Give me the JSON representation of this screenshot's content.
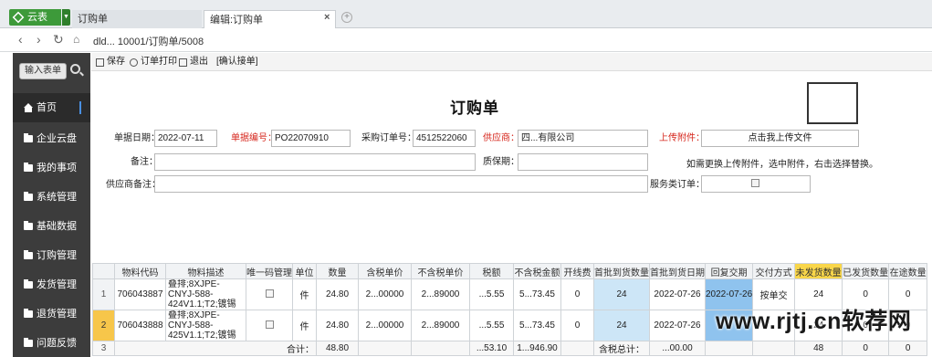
{
  "browser": {
    "brand": "云表",
    "tabs": [
      {
        "label": "订购单"
      },
      {
        "label": "编辑:订购单"
      }
    ],
    "close_glyph": "×",
    "add_glyph": "+",
    "address": "dld... 10001/订购单/5008"
  },
  "sidebar": {
    "search_button": "输入表单",
    "items": [
      {
        "label": "首页"
      },
      {
        "label": "企业云盘"
      },
      {
        "label": "我的事项"
      },
      {
        "label": "系统管理"
      },
      {
        "label": "基础数据"
      },
      {
        "label": "订购管理"
      },
      {
        "label": "发货管理"
      },
      {
        "label": "退货管理"
      },
      {
        "label": "问题反馈"
      }
    ]
  },
  "toolbar": {
    "save": "保存",
    "print": "订单打印",
    "exit": "退出",
    "confirm": "[确认接单]"
  },
  "form": {
    "title": "订购单",
    "doc_date_label": "单据日期：",
    "doc_date": "2022-07-11",
    "doc_no_label": "单据编号：",
    "doc_no": "PO22070910",
    "po_no_label": "采购订单号：",
    "po_no": "4512522060",
    "supplier_label": "供应商：",
    "supplier": "四...有限公司",
    "attachment_label": "上传附件：",
    "upload_button": "点击我上传文件",
    "remark_label": "备注：",
    "remark": "",
    "warranty_label": "质保期：",
    "warranty": "",
    "hint": "如需更换上传附件，选中附件，右击选择替换。",
    "supplier_remark_label": "供应商备注：",
    "supplier_remark": "",
    "service_order_label": "服务类订单："
  },
  "table": {
    "headers": [
      "",
      "物料代码",
      "物料描述",
      "唯一码管理",
      "单位",
      "数量",
      "含税单价",
      "不含税单价",
      "税额",
      "不含税金额",
      "开线费",
      "首批到货数量",
      "首批到货日期",
      "回复交期",
      "交付方式",
      "未发货数量",
      "已发货数量",
      "在途数量"
    ],
    "rows": [
      {
        "no": "1",
        "code": "706043887",
        "desc": "叠排;8XJPE-CNYJ-588-424V1.1;T2;镀锡",
        "unit": "件",
        "qty": "24.80",
        "price_tax": "2...00000",
        "price_notax": "2...89000",
        "tax": "...5.55",
        "amount_notax": "5...73.45",
        "line_fee": "0",
        "first_qty": "24",
        "first_date": "2022-07-26",
        "reply_date": "2022-07-26",
        "delivery": "按单交",
        "unshipped": "24",
        "shipped": "0",
        "transit": "0"
      },
      {
        "no": "2",
        "code": "706043888",
        "desc": "叠排;8XJPE-CNYJ-588-425V1.1;T2;镀锡",
        "unit": "件",
        "qty": "24.80",
        "price_tax": "2...00000",
        "price_notax": "2...89000",
        "tax": "...5.55",
        "amount_notax": "5...73.45",
        "line_fee": "0",
        "first_qty": "24",
        "first_date": "2022-07-26",
        "reply_date": "",
        "delivery": "",
        "unshipped": "24",
        "shipped": "0",
        "transit": "0"
      }
    ],
    "total": {
      "no": "3",
      "label": "合计：",
      "qty": "48.80",
      "tax": "...53.10",
      "amount_notax": "1...946.90",
      "tax_total_label": "含税总计：",
      "tax_total": "...00.00",
      "unshipped": "48",
      "shipped": "0",
      "transit": "0"
    }
  },
  "watermark": "www.rjtj.cn软荐网",
  "colors": {
    "accent_yellow": "#f9d64a",
    "sidebar_bg": "#3c3c3c",
    "brand_green": "#3d9a3a",
    "required_red": "#d6261c",
    "highlight_blue": "#cde6f7"
  }
}
